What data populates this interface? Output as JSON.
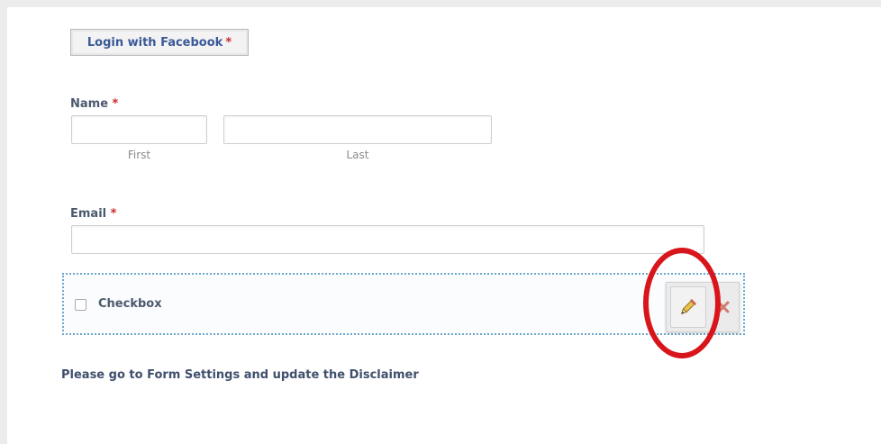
{
  "facebook_login": {
    "label": "Login with Facebook",
    "required_marker": "*"
  },
  "name_field": {
    "label": "Name",
    "required_marker": "*",
    "first": {
      "value": "",
      "sublabel": "First"
    },
    "last": {
      "value": "",
      "sublabel": "Last"
    }
  },
  "email_field": {
    "label": "Email",
    "required_marker": "*",
    "value": ""
  },
  "checkbox_field": {
    "label": "Checkbox",
    "checked": false,
    "toolbar": {
      "edit_icon": "pencil-icon",
      "delete_icon": "close-icon"
    }
  },
  "disclaimer_text": "Please go to Form Settings and update the Disclaimer",
  "colors": {
    "facebook_blue": "#3b5998",
    "required_red": "#cc2a2a",
    "highlight_red": "#d8151b",
    "selection_dotted_border": "#6ea8cc"
  }
}
